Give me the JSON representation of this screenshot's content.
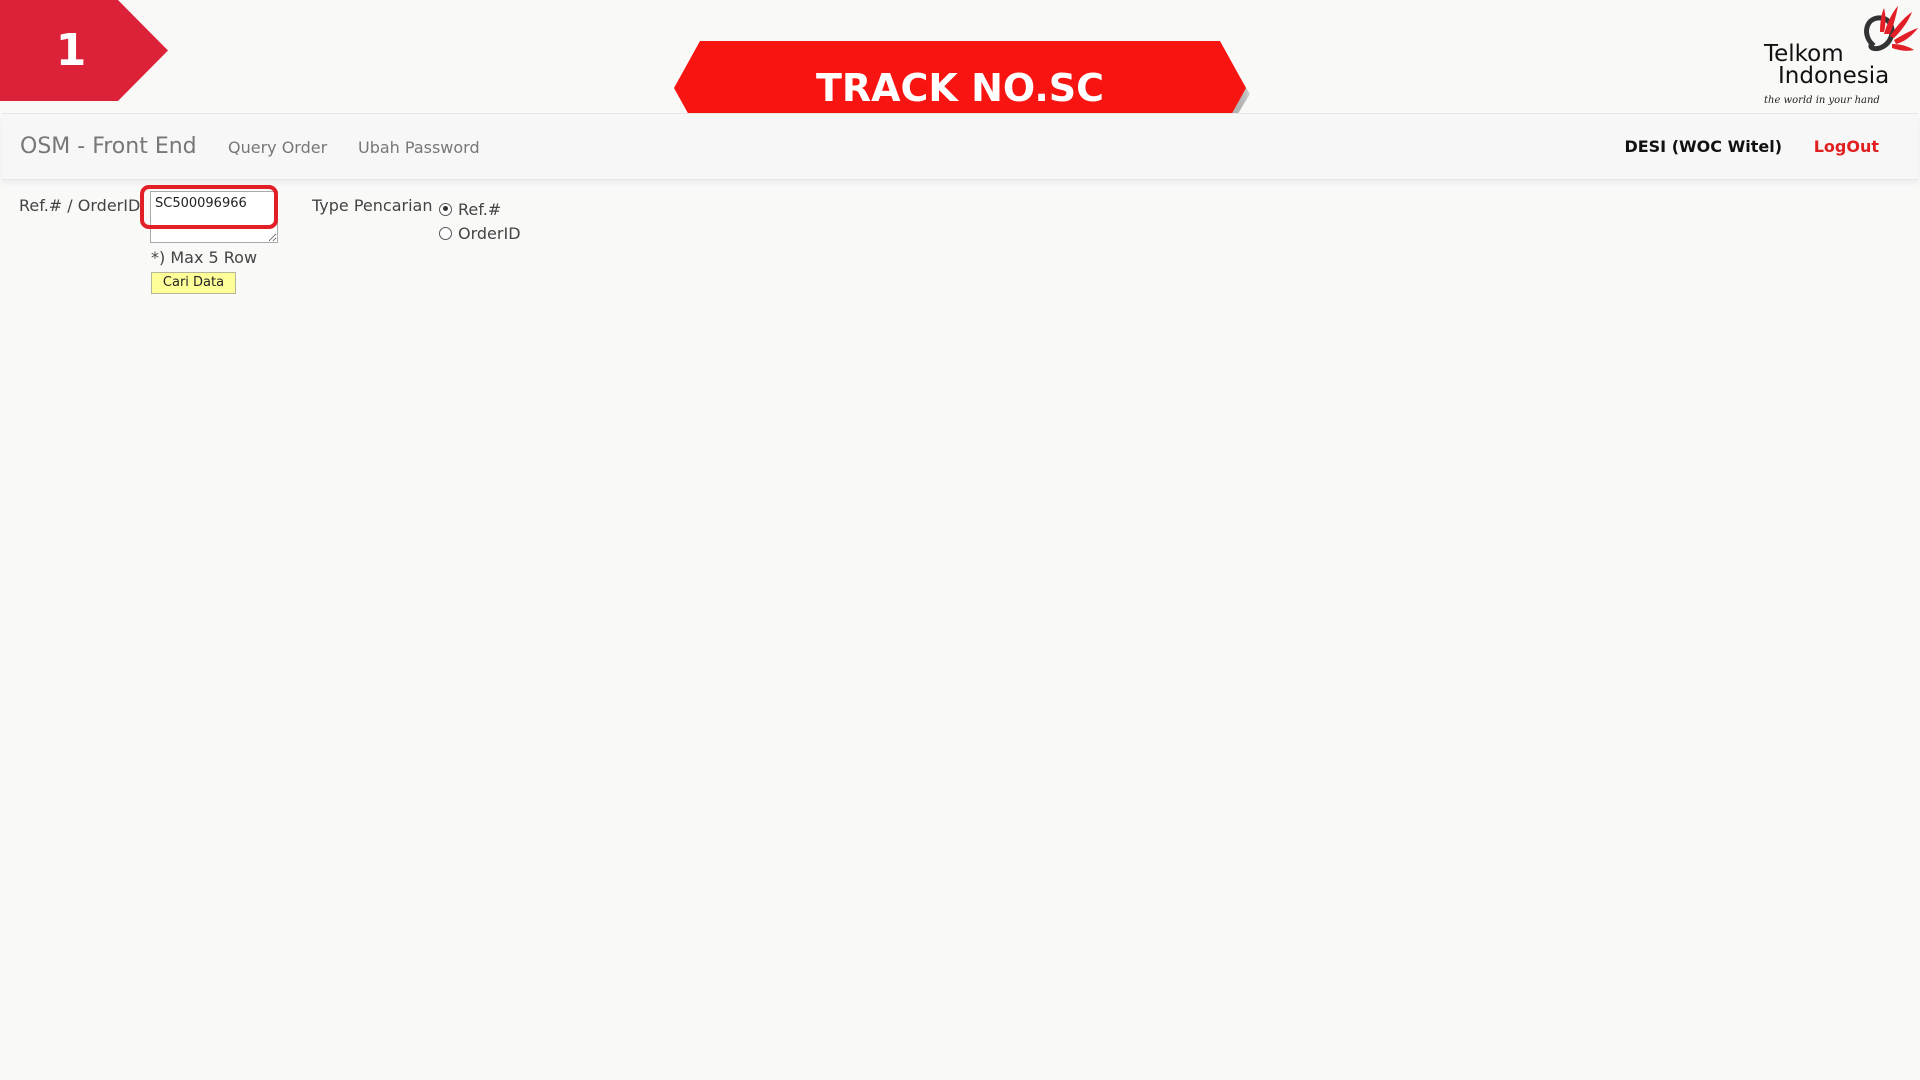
{
  "step": {
    "number": "1"
  },
  "banner": {
    "title": "TRACK NO.SC"
  },
  "logo": {
    "brand_line1": "Telkom",
    "brand_line2": "Indonesia",
    "tagline": "the world in your hand"
  },
  "navbar": {
    "brand": "OSM - Front End",
    "links": [
      {
        "label": "Query Order"
      },
      {
        "label": "Ubah Password"
      }
    ],
    "user": "DESI (WOC Witel)",
    "logout_label": "LogOut"
  },
  "form": {
    "ref_label": "Ref.# / OrderID",
    "ref_value": "SC500096966",
    "hint": "*) Max 5 Row",
    "search_button": "Cari Data",
    "type_label": "Type Pencarian",
    "type_options": [
      {
        "label": "Ref.#",
        "checked": true
      },
      {
        "label": "OrderID",
        "checked": false
      }
    ]
  },
  "colors": {
    "accent_red": "#f81410",
    "badge_red": "#dc2238",
    "highlight_red": "#e21f26",
    "button_yellow": "#ffff99",
    "logout_red": "#e02020"
  }
}
